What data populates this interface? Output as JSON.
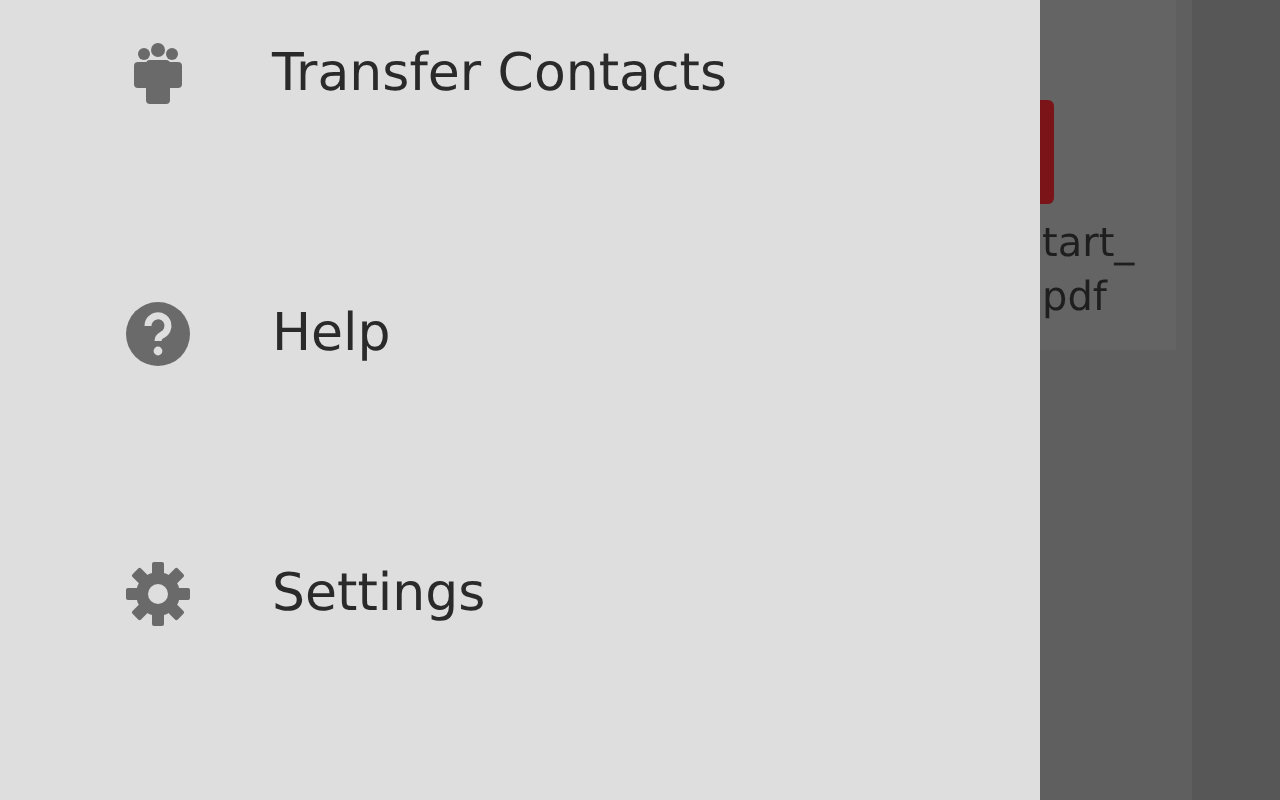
{
  "drawer": {
    "items": [
      {
        "kind": "contacts",
        "label": "Transfer Contacts"
      },
      {
        "kind": "help",
        "label": "Help"
      },
      {
        "kind": "settings",
        "label": "Settings"
      }
    ]
  },
  "background_file": {
    "name_lines": [
      "tart_",
      "pdf"
    ]
  }
}
